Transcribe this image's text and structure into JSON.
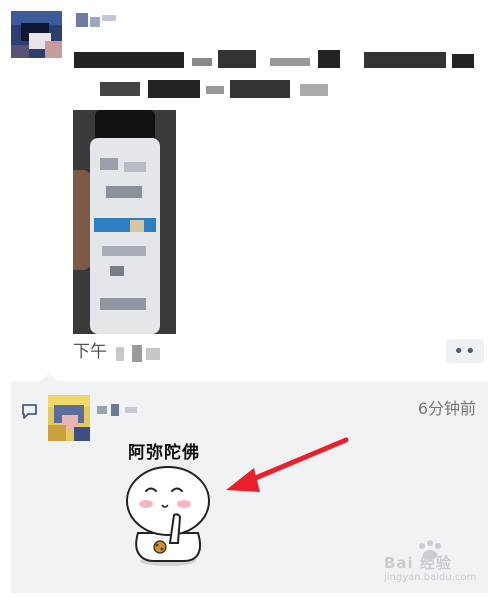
{
  "post": {
    "timestamp_prefix": "下午",
    "more_button_label": "••"
  },
  "comment": {
    "time_ago": "6分钟前",
    "sticker_caption": "阿弥陀佛"
  },
  "watermark": {
    "brand": "Bai 经验",
    "domain": "jingyan.baidu.com"
  },
  "icons": {
    "comment": "comment-bubble-icon",
    "more": "ellipsis-icon",
    "arrow": "red-arrow"
  },
  "colors": {
    "comment_bg": "#f1f2f4",
    "link_blue": "#4b5d7c",
    "arrow_red": "#e8202a"
  }
}
